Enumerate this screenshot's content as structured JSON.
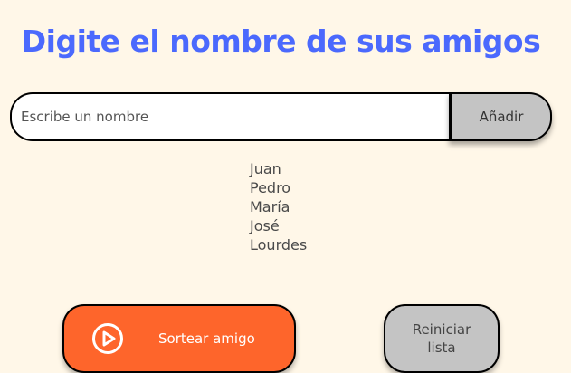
{
  "header": {
    "title": "Digite el nombre de sus amigos"
  },
  "input_section": {
    "placeholder": "Escribe un nombre",
    "value": "",
    "add_label": "Añadir"
  },
  "friends": [
    {
      "name": "Juan"
    },
    {
      "name": "Pedro"
    },
    {
      "name": "María"
    },
    {
      "name": "José"
    },
    {
      "name": "Lourdes"
    }
  ],
  "actions": {
    "draw_label": "Sortear amigo",
    "draw_icon": "play-circle-icon",
    "reset_label": "Reiniciar lista"
  },
  "colors": {
    "background": "#fff7e8",
    "title": "#4b69fd",
    "primary_button": "#fe652b",
    "secondary_button": "#c4c4c4"
  }
}
